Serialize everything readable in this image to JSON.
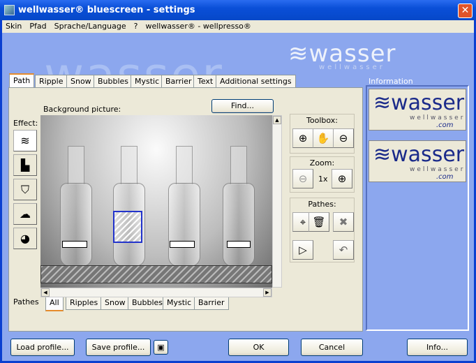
{
  "window": {
    "title": "wellwasser® bluescreen - settings"
  },
  "menu": [
    "Skin",
    "Pfad",
    "Sprache/Language",
    "?",
    "wellwasser® - wellpresso®"
  ],
  "watermark": "wasser",
  "brand_logo": {
    "main": "wasser",
    "sub": "wellwasser"
  },
  "tabs": [
    {
      "label": "Path",
      "active": true
    },
    {
      "label": "Ripple"
    },
    {
      "label": "Snow"
    },
    {
      "label": "Bubbles"
    },
    {
      "label": "Mystic"
    },
    {
      "label": "Barrier"
    },
    {
      "label": "Text"
    },
    {
      "label": "Additional settings"
    }
  ],
  "path_tab": {
    "effect_label": "Effect:",
    "effects": [
      {
        "icon": "waves-icon",
        "active": true
      },
      {
        "icon": "snow-city-icon"
      },
      {
        "icon": "bubbles-glass-icon"
      },
      {
        "icon": "mystic-icon"
      },
      {
        "icon": "barrier-pacman-icon"
      }
    ],
    "background_label": "Background picture:",
    "find_button": "Find...",
    "toolbox": {
      "title": "Toolbox:",
      "buttons": [
        "zoom-in-icon",
        "hand-icon",
        "zoom-out-icon"
      ]
    },
    "zoom": {
      "title": "Zoom:",
      "level": "1x"
    },
    "pathes": {
      "title": "Pathes:",
      "buttons": [
        "new-path-icon",
        "trash-icon",
        "delete-x-icon",
        "triangle-icon",
        "undo-icon"
      ]
    },
    "pathes_label": "Pathes",
    "path_filters": [
      {
        "label": "All",
        "active": true
      },
      {
        "label": "Ripples"
      },
      {
        "label": "Snow"
      },
      {
        "label": "Bubbles"
      },
      {
        "label": "Mystic"
      },
      {
        "label": "Barrier"
      }
    ]
  },
  "information": {
    "title": "Information",
    "logos": [
      {
        "main": "wasser",
        "sub": "wellwasser",
        "domain": ".com"
      },
      {
        "main": "wasser",
        "sub": "wellwasser",
        "domain": ".com"
      }
    ]
  },
  "footer": {
    "load": "Load profile...",
    "save": "Save profile...",
    "ok": "OK",
    "cancel": "Cancel",
    "info": "Info..."
  }
}
